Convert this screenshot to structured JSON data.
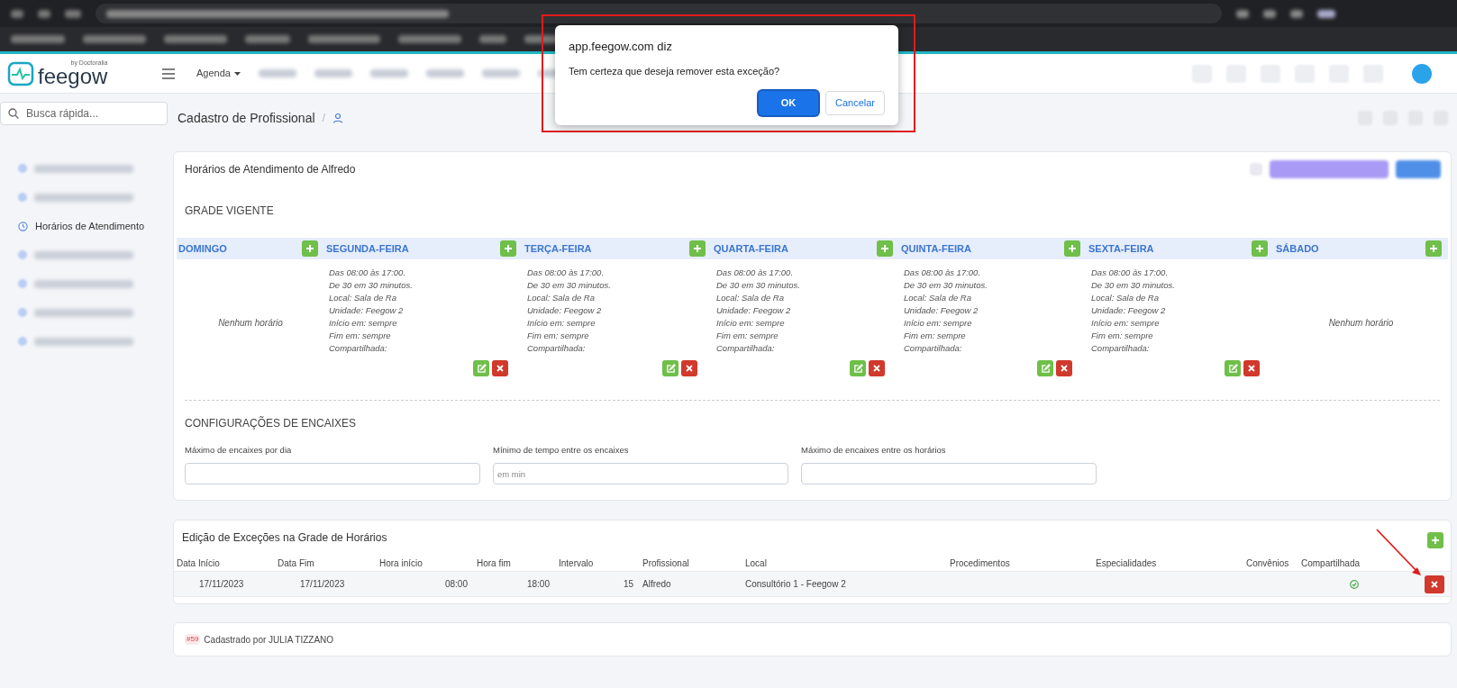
{
  "app_header": {
    "logo": "feegow",
    "logo_tagline": "by Doctoralia",
    "nav": [
      {
        "label": "Agenda",
        "blurred": false,
        "has_menu": true
      },
      {
        "blurred": true
      },
      {
        "blurred": true
      },
      {
        "blurred": true
      },
      {
        "blurred": true
      },
      {
        "blurred": true
      },
      {
        "blurred": true
      }
    ]
  },
  "search": {
    "placeholder": "Busca rápida..."
  },
  "sidebar": {
    "items": [
      {
        "blurred": true,
        "selected": false
      },
      {
        "blurred": true,
        "selected": false
      },
      {
        "label": "Horários de Atendimento",
        "blurred": false,
        "selected": true
      },
      {
        "blurred": true,
        "selected": false
      },
      {
        "blurred": true,
        "selected": false
      },
      {
        "blurred": true,
        "selected": false
      },
      {
        "blurred": true,
        "selected": false
      }
    ]
  },
  "page": {
    "title": "Cadastro de Profissional",
    "separator": "/"
  },
  "schedule_card": {
    "title": "Horários de Atendimento de Alfredo",
    "section": "GRADE VIGENTE",
    "days": [
      {
        "name": "DOMINGO",
        "kind": "empty",
        "empty_text": "Nenhum horário"
      },
      {
        "name": "SEGUNDA-FEIRA",
        "kind": "schedule",
        "lines": [
          "Das 08:00 às 17:00.",
          "De 30 em 30 minutos.",
          "Local: Sala de Ra",
          "Unidade: Feegow 2",
          "Início em: sempre",
          "Fim em: sempre",
          "Compartilhada:"
        ]
      },
      {
        "name": "TERÇA-FEIRA",
        "kind": "schedule",
        "lines": [
          "Das 08:00 às 17:00.",
          "De 30 em 30 minutos.",
          "Local: Sala de Ra",
          "Unidade: Feegow 2",
          "Início em: sempre",
          "Fim em: sempre",
          "Compartilhada:"
        ]
      },
      {
        "name": "QUARTA-FEIRA",
        "kind": "schedule",
        "lines": [
          "Das 08:00 às 17:00.",
          "De 30 em 30 minutos.",
          "Local: Sala de Ra",
          "Unidade: Feegow 2",
          "Início em: sempre",
          "Fim em: sempre",
          "Compartilhada:"
        ]
      },
      {
        "name": "QUINTA-FEIRA",
        "kind": "schedule",
        "lines": [
          "Das 08:00 às 17:00.",
          "De 30 em 30 minutos.",
          "Local: Sala de Ra",
          "Unidade: Feegow 2",
          "Início em: sempre",
          "Fim em: sempre",
          "Compartilhada:"
        ]
      },
      {
        "name": "SEXTA-FEIRA",
        "kind": "schedule",
        "lines": [
          "Das 08:00 às 17:00.",
          "De 30 em 30 minutos.",
          "Local: Sala de Ra",
          "Unidade: Feegow 2",
          "Início em: sempre",
          "Fim em: sempre",
          "Compartilhada:"
        ]
      },
      {
        "name": "SÁBADO",
        "kind": "empty",
        "empty_text": "Nenhum horário"
      }
    ],
    "encaixes": {
      "title": "CONFIGURAÇÕES DE ENCAIXES",
      "fields": [
        {
          "label": "Máximo de encaixes por dia"
        },
        {
          "label": "Mínimo de tempo entre os encaixes",
          "placeholder": "em min"
        },
        {
          "label": "Máximo de encaixes entre os horários"
        }
      ]
    }
  },
  "exceptions": {
    "title": "Edição de Exceções na Grade de Horários",
    "columns": [
      "Data Início",
      "Data Fim",
      "Hora início",
      "Hora fim",
      "Intervalo",
      "Profissional",
      "Local",
      "Procedimentos",
      "Especialidades",
      "Convênios",
      "Compartilhada"
    ],
    "rows": [
      {
        "cells": [
          "17/11/2023",
          "17/11/2023",
          "08:00",
          "18:00",
          "15",
          "Alfredo",
          "Consultório 1 - Feegow 2"
        ],
        "shared": true
      }
    ]
  },
  "footer": {
    "badge": "#59",
    "text": "Cadastrado por JULIA TIZZANO"
  },
  "dialog": {
    "origin": "app.feegow.com diz",
    "message": "Tem certeza que deseja remover esta exceção?",
    "buttons": [
      {
        "label": "OK",
        "kind": "primary"
      },
      {
        "label": "Cancelar",
        "kind": "secondary"
      }
    ]
  }
}
